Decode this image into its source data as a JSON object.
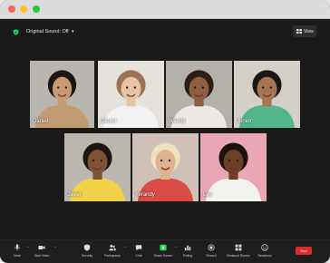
{
  "topbar": {
    "sound_label": "Original Sound: Off",
    "view_label": "View"
  },
  "participants": [
    {
      "name": "Daniel",
      "bg": "#b9b6b0",
      "skin": "#c89a73",
      "hair": "#1b1714",
      "shirt": "#c19b72"
    },
    {
      "name": "Giovel",
      "bg": "#e5e2dc",
      "skin": "#e6c4a6",
      "hair": "#9b7354",
      "shirt": "#f2f2f2"
    },
    {
      "name": "Wendy",
      "bg": "#b4b1ab",
      "skin": "#8e5e40",
      "hair": "#2d1d14",
      "shirt": "#ece9e2"
    },
    {
      "name": "Junior",
      "bg": "#d4d0c8",
      "skin": "#a87553",
      "hair": "#1d1713",
      "shirt": "#53b68a"
    },
    {
      "name": "Javier",
      "bg": "#bbb6ae",
      "skin": "#7d5336",
      "hair": "#1c1612",
      "shirt": "#f1d14a"
    },
    {
      "name": "Yerandy",
      "bg": "#cfc0b8",
      "skin": "#e0b18e",
      "hair": "#ede1bf",
      "shirt": "#d84c45"
    },
    {
      "name": "Leo",
      "bg": "#e9a6b4",
      "skin": "#6b4027",
      "hair": "#1b120c",
      "shirt": "#f2f2ee"
    }
  ],
  "toolbar": {
    "mute": "Mute",
    "start_video": "Start Video",
    "security": "Security",
    "participants": "Participants",
    "chat": "Chat",
    "share_screen": "Share Screen",
    "polling": "Polling",
    "record": "Record",
    "breakout_rooms": "Breakout Rooms",
    "reactions": "Reactions",
    "end": "End"
  },
  "colors": {
    "end_button": "#d92d2b",
    "share_screen": "#23d959",
    "shield": "#23d959"
  }
}
